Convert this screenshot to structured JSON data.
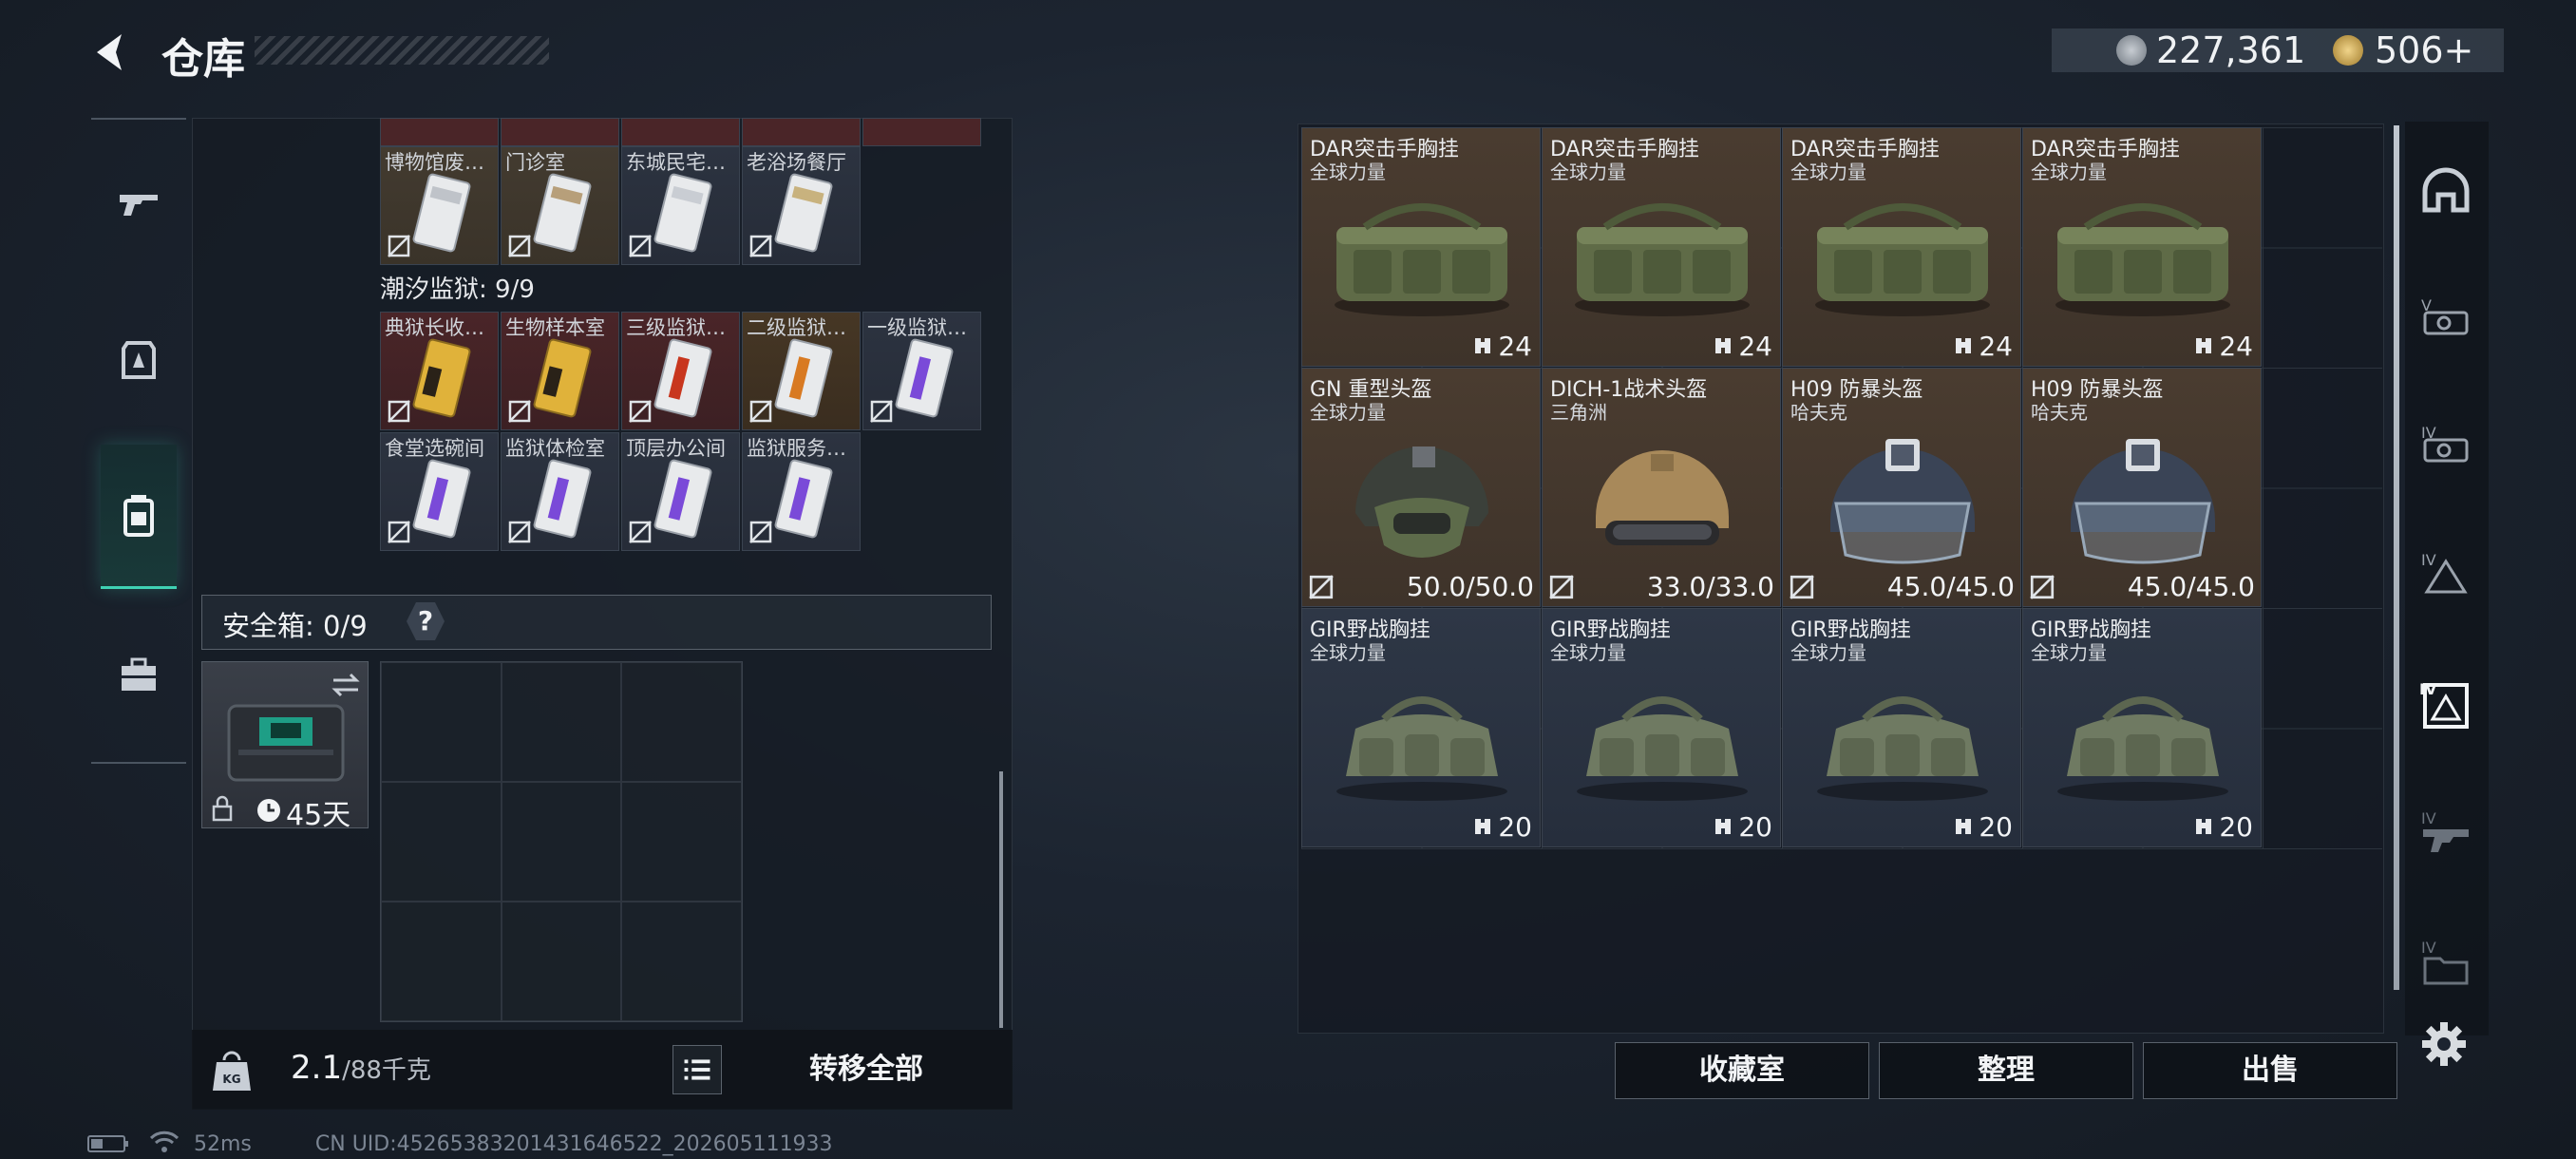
{
  "header": {
    "title": "仓库",
    "currency": [
      {
        "icon": "coin-icon",
        "value": "227,361"
      },
      {
        "icon": "gold-bond-icon",
        "value": "506+"
      }
    ]
  },
  "left_rail": {
    "items": [
      {
        "icon": "gun-icon",
        "active": false
      },
      {
        "icon": "armor-icon",
        "active": false
      },
      {
        "icon": "backpack-icon",
        "active": true
      },
      {
        "icon": "briefcase-icon",
        "active": false
      }
    ]
  },
  "keycards": {
    "top_row": [
      "博物馆废…",
      "门诊室",
      "东城民宅…",
      "老浴场餐厅"
    ],
    "section_label": "潮汐监狱: 9/9",
    "prison_row1": [
      "典狱长收…",
      "生物样本室",
      "三级监狱…",
      "二级监狱…",
      "一级监狱…"
    ],
    "prison_row2": [
      "食堂选碗间",
      "监狱体检室",
      "顶层办公间",
      "监狱服务…"
    ]
  },
  "safebox": {
    "label": "安全箱: 0/9",
    "help": "?",
    "duration": "45天"
  },
  "footer": {
    "weight_current": "2.1",
    "weight_max": "/88千克",
    "transfer_all": "转移全部"
  },
  "gear": [
    {
      "name": "DAR突击手胸挂",
      "sub": "全球力量",
      "value": "24",
      "kind": "bag",
      "color": "tan"
    },
    {
      "name": "DAR突击手胸挂",
      "sub": "全球力量",
      "value": "24",
      "kind": "bag",
      "color": "tan"
    },
    {
      "name": "DAR突击手胸挂",
      "sub": "全球力量",
      "value": "24",
      "kind": "bag",
      "color": "tan"
    },
    {
      "name": "DAR突击手胸挂",
      "sub": "全球力量",
      "value": "24",
      "kind": "bag",
      "color": "tan"
    },
    {
      "name": "GN 重型头盔",
      "sub": "全球力量",
      "value": "50.0/50.0",
      "kind": "helmet-green",
      "color": "tan"
    },
    {
      "name": "DICH-1战术头盔",
      "sub": "三角洲",
      "value": "33.0/33.0",
      "kind": "helmet-tan",
      "color": "tan"
    },
    {
      "name": "H09 防暴头盔",
      "sub": "哈夫克",
      "value": "45.0/45.0",
      "kind": "helmet-navy",
      "color": "tan"
    },
    {
      "name": "H09 防暴头盔",
      "sub": "哈夫克",
      "value": "45.0/45.0",
      "kind": "helmet-navy",
      "color": "tan"
    },
    {
      "name": "GIR野战胸挂",
      "sub": "全球力量",
      "value": "20",
      "kind": "vest",
      "color": "blue"
    },
    {
      "name": "GIR野战胸挂",
      "sub": "全球力量",
      "value": "20",
      "kind": "vest",
      "color": "blue"
    },
    {
      "name": "GIR野战胸挂",
      "sub": "全球力量",
      "value": "20",
      "kind": "vest",
      "color": "blue"
    },
    {
      "name": "GIR野战胸挂",
      "sub": "全球力量",
      "value": "20",
      "kind": "vest",
      "color": "blue"
    }
  ],
  "right_rail": {
    "items": [
      "helmet-all-icon",
      "tier5-rig-icon",
      "tier4-rig-icon",
      "tier4-helmet-icon",
      "tier4-armor-icon",
      "tier4-gun-icon",
      "tier4-folder-icon"
    ]
  },
  "actions": {
    "collection": "收藏室",
    "organize": "整理",
    "sell": "出售"
  },
  "status": {
    "ping": "52ms",
    "uid": "CN UID:4526538320143164652​2_202605111933"
  },
  "colors": {
    "accent": "#3fd1b3",
    "tile_tan": "#433b30",
    "tile_blue": "#2c3340",
    "tile_red": "#4a2528"
  }
}
